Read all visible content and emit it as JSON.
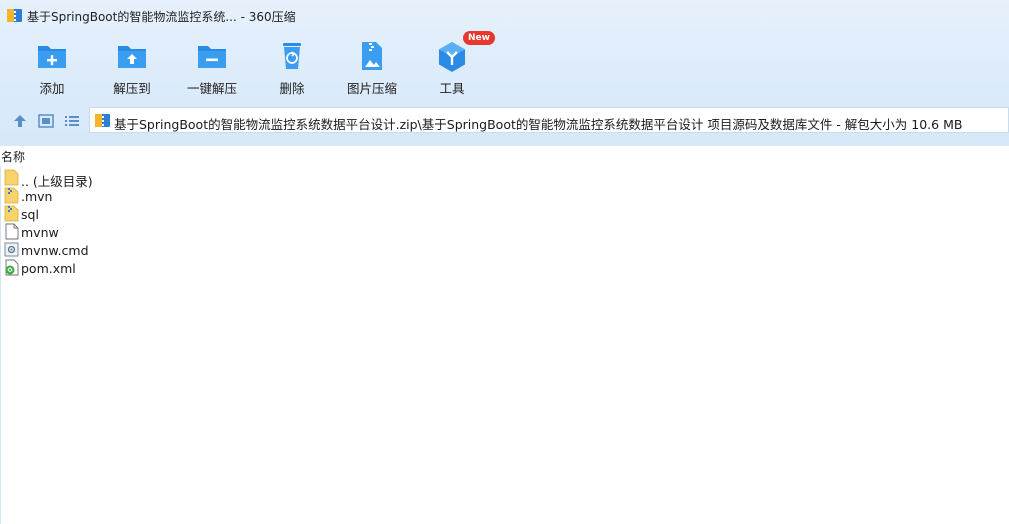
{
  "window": {
    "title": "基于SpringBoot的智能物流监控系统... - 360压缩"
  },
  "toolbar": {
    "buttons": [
      {
        "label": "添加",
        "icon": "add-folder-icon"
      },
      {
        "label": "解压到",
        "icon": "extract-to-icon"
      },
      {
        "label": "一键解压",
        "icon": "one-click-extract-icon"
      },
      {
        "label": "删除",
        "icon": "recycle-bin-icon"
      },
      {
        "label": "图片压缩",
        "icon": "image-compress-icon"
      },
      {
        "label": "工具",
        "icon": "tools-icon",
        "badge": "New"
      }
    ]
  },
  "nav": {
    "path": "基于SpringBoot的智能物流监控系统数据平台设计.zip\\基于SpringBoot的智能物流监控系统数据平台设计 项目源码及数据库文件 - 解包大小为 10.6 MB"
  },
  "list": {
    "header": "名称",
    "items": [
      {
        "name": ".. (上级目录)",
        "type": "folder"
      },
      {
        "name": ".mvn",
        "type": "folder"
      },
      {
        "name": "sql",
        "type": "folder"
      },
      {
        "name": "mvnw",
        "type": "file"
      },
      {
        "name": "mvnw.cmd",
        "type": "cmd"
      },
      {
        "name": "pom.xml",
        "type": "xml"
      }
    ]
  },
  "colors": {
    "accent": "#1e88e5",
    "toolbar_bg": "#dcebfa",
    "badge": "#e8372c"
  }
}
